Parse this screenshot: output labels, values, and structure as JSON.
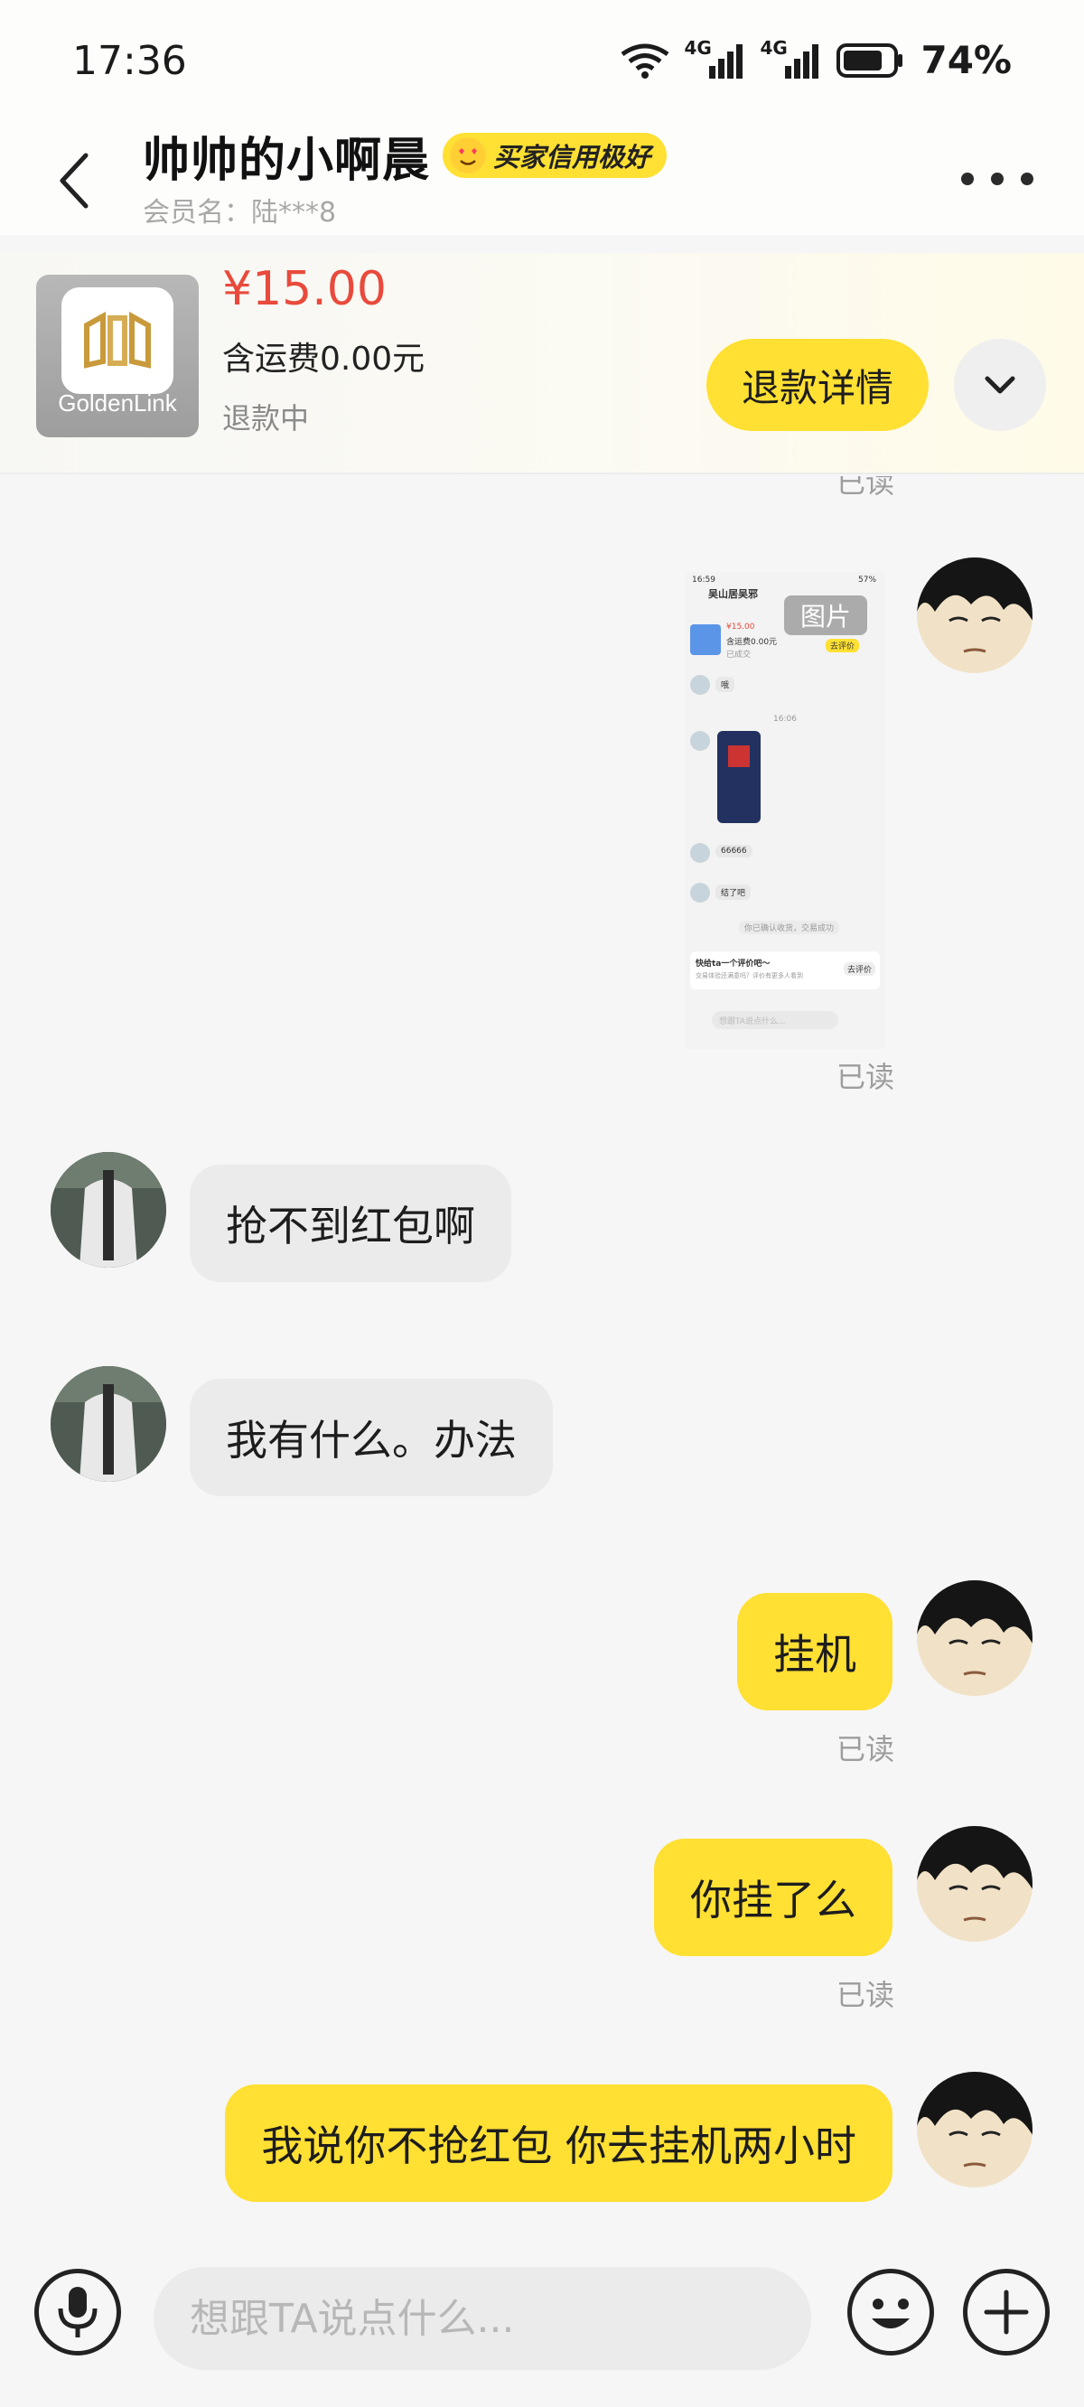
{
  "status_bar": {
    "time": "17:36",
    "network1": "4G",
    "network2": "4G",
    "battery": "74%"
  },
  "header": {
    "title": "帅帅的小啊晨",
    "credit_badge": "买家信用极好",
    "member": "会员名：陆***8"
  },
  "order": {
    "thumb_text": "GoldenLink",
    "price": "¥15.00",
    "shipping": "含运费0.00元",
    "status": "退款中",
    "refund_button": "退款详情"
  },
  "chat": {
    "read_label": "已读",
    "image_label": "图片",
    "image_preview": {
      "time": "16:59",
      "battery": "57%",
      "shop": "吴山居吴邪",
      "price": "¥15.00",
      "shipping": "含运费0.00元",
      "status": "已成交",
      "eval_button": "去评价",
      "msg1": "哦",
      "timestamp": "16:06",
      "msg2": "66666",
      "msg3": "结了吧",
      "notice": "你已确认收货，交易成功",
      "card_title": "快给ta一个评价吧～",
      "card_sub": "交易体验还满意吗？评价有更多人看到",
      "card_btn": "去评价",
      "placeholder": "想跟TA说点什么..."
    },
    "messages": [
      {
        "side": "other",
        "text": "抢不到红包啊"
      },
      {
        "side": "other",
        "text": "我有什么。办法"
      },
      {
        "side": "me",
        "text": "挂机"
      },
      {
        "side": "me",
        "text": "你挂了么"
      },
      {
        "side": "me",
        "text": "我说你不抢红包 你去挂机两小时"
      }
    ]
  },
  "input": {
    "placeholder": "想跟TA说点什么..."
  },
  "colors": {
    "accent": "#ffe033",
    "price": "#e84a3c",
    "other_bubble": "#ebebeb"
  }
}
